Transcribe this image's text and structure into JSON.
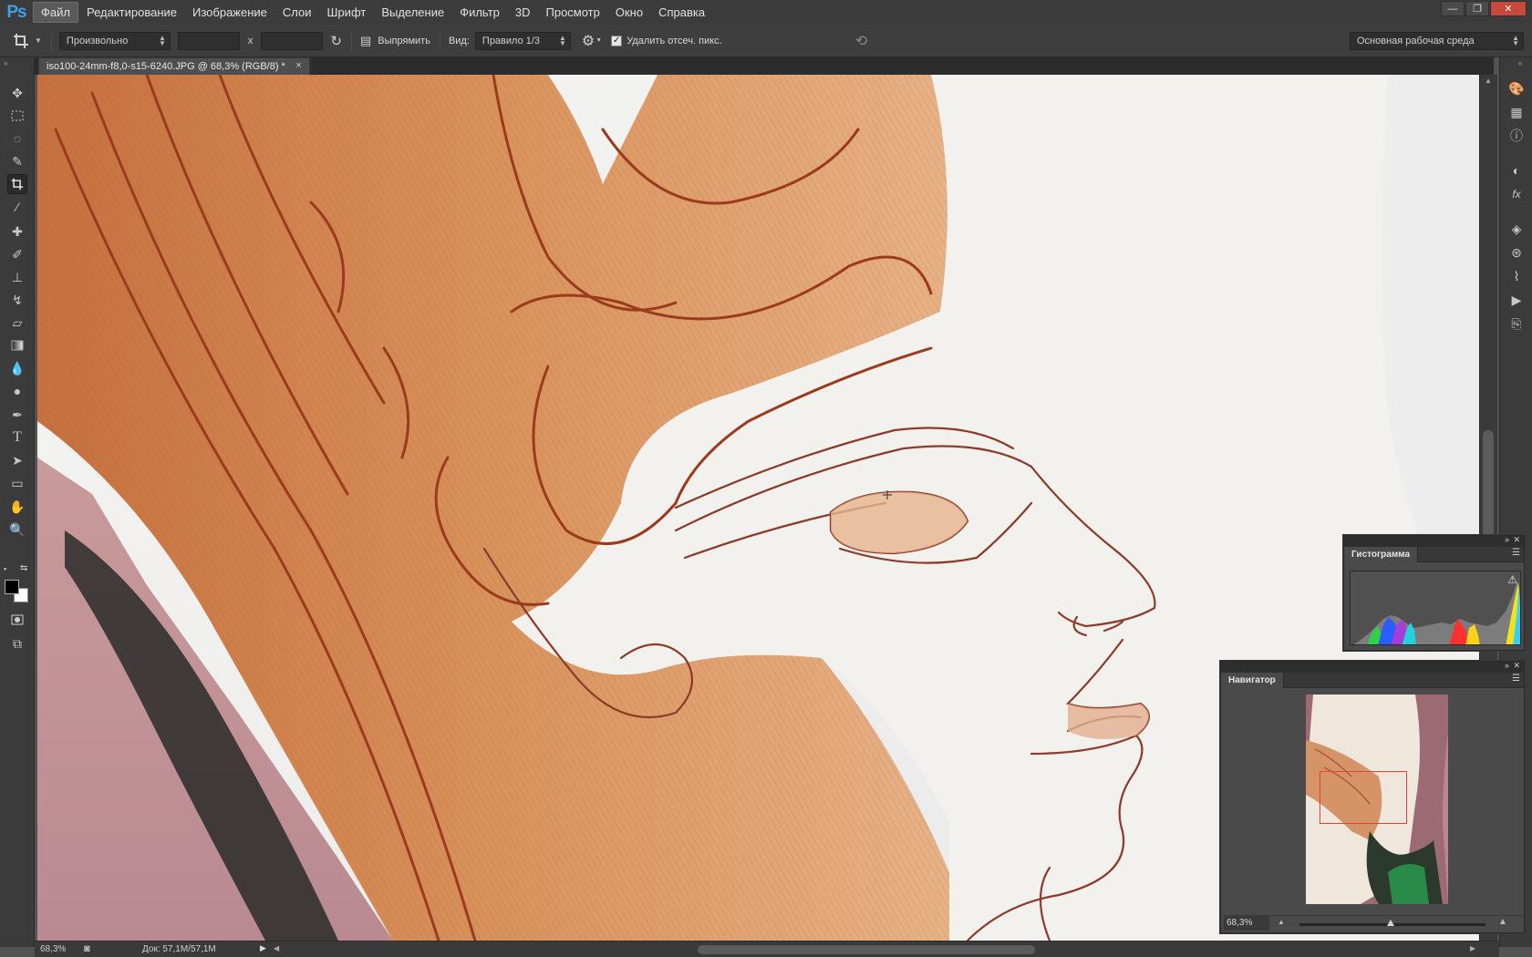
{
  "app": {
    "logo": "Ps"
  },
  "menu": [
    "Файл",
    "Редактирование",
    "Изображение",
    "Слои",
    "Шрифт",
    "Выделение",
    "Фильтр",
    "3D",
    "Просмотр",
    "Окно",
    "Справка"
  ],
  "window_buttons": {
    "minimize": "—",
    "restore": "❐",
    "close": "✕"
  },
  "options": {
    "ratio_select": "Произвольно",
    "x_separator": "x",
    "straighten_label": "Выпрямить",
    "view_label": "Вид:",
    "view_select": "Правило 1/3",
    "delete_cropped_label": "Удалить отсеч. пикс.",
    "delete_cropped_checked": true,
    "workspace_select": "Основная рабочая среда"
  },
  "document": {
    "tab_title": "iso100-24mm-f8,0-s15-6240.JPG @ 68,3% (RGB/8) *",
    "close": "×"
  },
  "status": {
    "zoom": "68,3%",
    "doc_info": "Док: 57,1M/57,1M"
  },
  "histogram": {
    "title": "Гистограмма"
  },
  "navigator": {
    "title": "Навигатор",
    "zoom": "68,3%"
  },
  "colors": {
    "foreground": "#000000",
    "background": "#ffffff",
    "accent": "#3fa0e8",
    "nav_view_box": "#e8403a"
  },
  "tools": [
    "move-icon",
    "marquee-icon",
    "lasso-icon",
    "quick-select-icon",
    "crop-icon",
    "eyedropper-icon",
    "healing-icon",
    "brush-icon",
    "stamp-icon",
    "history-brush-icon",
    "eraser-icon",
    "gradient-icon",
    "blur-icon",
    "dodge-icon",
    "pen-icon",
    "type-icon",
    "path-select-icon",
    "rectangle-icon",
    "hand-icon",
    "zoom-icon"
  ],
  "dock_icons": [
    "color-icon",
    "swatches-icon",
    "info-icon",
    "adjustments-icon",
    "styles-icon",
    "layers-icon",
    "channels-icon",
    "paths-icon",
    "actions-icon",
    "history-icon"
  ]
}
